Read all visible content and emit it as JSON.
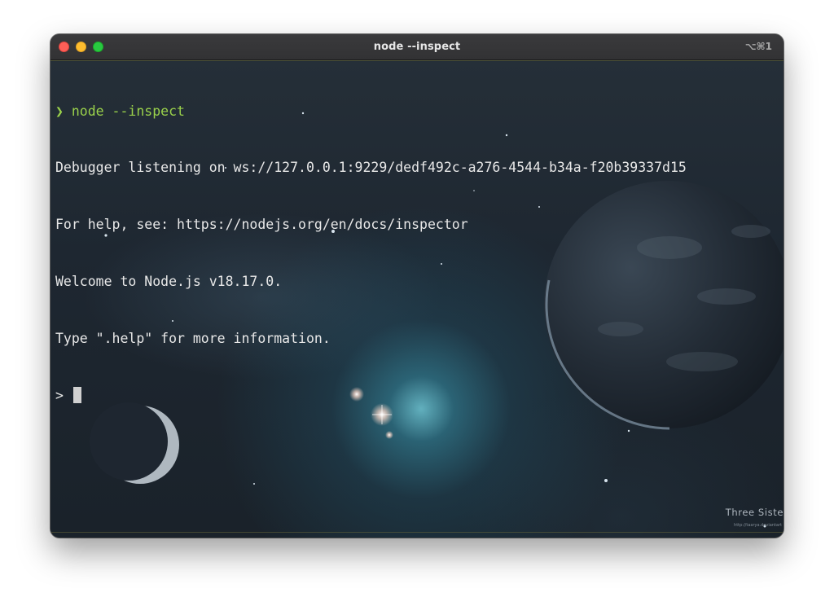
{
  "window": {
    "title": "node --inspect",
    "shortcut": "⌥⌘1"
  },
  "terminal": {
    "prompt_symbol": "❯",
    "command": "node --inspect",
    "output": [
      "Debugger listening on ws://127.0.0.1:9229/dedf492c-a276-4544-b34a-f20b39337d15",
      "For help, see: https://nodejs.org/en/docs/inspector",
      "Welcome to Node.js v18.17.0.",
      "Type \".help\" for more information."
    ],
    "repl_prompt": ">"
  },
  "wallpaper": {
    "watermark": "Three Siste",
    "watermark_url": "http://taarya.deviantart"
  },
  "colors": {
    "prompt_accent": "#9ad14b",
    "text": "#e8e8e8",
    "close": "#fe5f57",
    "minimize": "#febc2e",
    "zoom": "#28c840"
  }
}
